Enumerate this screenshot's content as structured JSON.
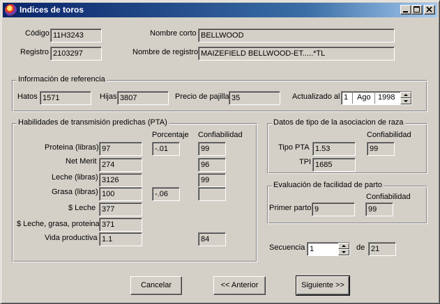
{
  "window": {
    "title": "Indices de toros"
  },
  "header": {
    "codigo_label": "Código",
    "codigo": "11H3243",
    "registro_label": "Registro",
    "registro": "2103297",
    "nombre_corto_label": "Nombre corto",
    "nombre_corto": "BELLWOOD",
    "nombre_registro_label": "Nombre de registro",
    "nombre_registro": "MAIZEFIELD BELLWOOD-ET.....*TL"
  },
  "referencia": {
    "title": "Información de referencia",
    "hatos_label": "Hatos",
    "hatos": "1571",
    "hijas_label": "Hijas",
    "hijas": "3807",
    "precio_label": "Precio de pajilla",
    "precio": "35",
    "actualizado_label": "Actualizado al",
    "day": "1",
    "month": "Ago",
    "year": "1998"
  },
  "pta": {
    "title": "Habilidades de transmisión predichas (PTA)",
    "col_porcentaje": "Porcentaje",
    "col_confiabilidad": "Confiabilidad",
    "rows": [
      {
        "label": "Proteina (libras)",
        "value": "97",
        "porcentaje": "-.01",
        "confiabilidad": "99"
      },
      {
        "label": "Net Merit",
        "value": "274",
        "porcentaje": "",
        "confiabilidad": "96"
      },
      {
        "label": "Leche (libras)",
        "value": "3126",
        "porcentaje": "",
        "confiabilidad": "99"
      },
      {
        "label": "Grasa (libras)",
        "value": "100",
        "porcentaje": "-.06",
        "confiabilidad": ""
      },
      {
        "label": "$ Leche",
        "value": "377",
        "porcentaje": "",
        "confiabilidad": ""
      },
      {
        "label": "$ Leche, grasa, proteina",
        "value": "371",
        "porcentaje": "",
        "confiabilidad": ""
      },
      {
        "label": "Vida productiva",
        "value": "1.1",
        "porcentaje": "",
        "confiabilidad": "84"
      }
    ]
  },
  "raza": {
    "title": "Datos de tipo de la asociacion de raza",
    "col_confiabilidad": "Confiabilidad",
    "tipo_pta_label": "Tipo PTA",
    "tipo_pta": "1.53",
    "tipo_pta_conf": "99",
    "tpi_label": "TPI",
    "tpi": "1685"
  },
  "parto": {
    "title": "Evaluación de facilidad de parto",
    "col_confiabilidad": "Confiabilidad",
    "primer_parto_label": "Primer parto",
    "primer_parto": "9",
    "primer_parto_conf": "99"
  },
  "secuencia": {
    "label": "Secuencia",
    "value": "1",
    "de_label": "de",
    "total": "21"
  },
  "buttons": {
    "cancel": "Cancelar",
    "prev": "<< Anterior",
    "next": "Siguiente >>"
  }
}
